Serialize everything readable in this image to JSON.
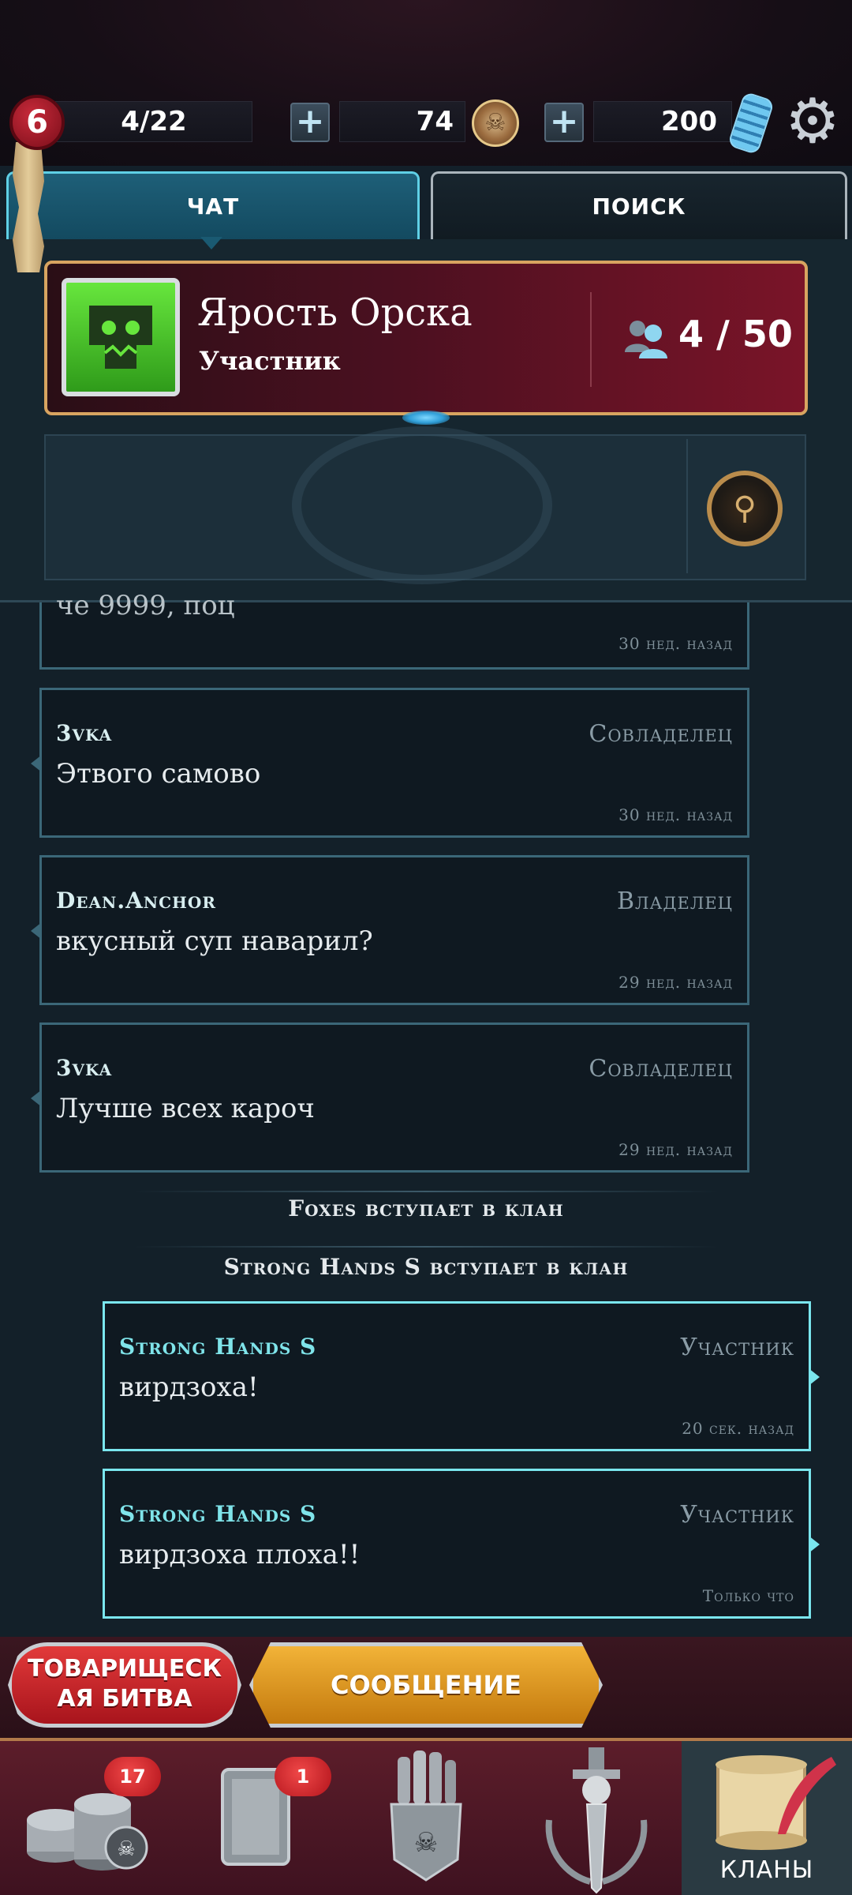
{
  "resources": {
    "level": "6",
    "cards": "4/22",
    "gold": "74",
    "gems": "200",
    "plus": "+"
  },
  "tabs": [
    {
      "label": "ЧАТ",
      "active": true
    },
    {
      "label": "ПОИСК",
      "active": false
    }
  ],
  "clan": {
    "name": "Ярость Орска",
    "rank": "Участник",
    "members": "4 / 50"
  },
  "chat": {
    "partial_text": "че 9999, поц",
    "partial_time": "30 нед. назад",
    "messages": [
      {
        "author": "3vka",
        "role": "Совладелец",
        "text": "Этвого самово",
        "time": "30 нед. назад",
        "own": false
      },
      {
        "author": "Dean.Anchor",
        "role": "Владелец",
        "text": "вкусный суп наварил?",
        "time": "29 нед. назад",
        "own": false
      },
      {
        "author": "3vka",
        "role": "Совладелец",
        "text": "Лучше всех кароч",
        "time": "29 нед. назад",
        "own": false
      },
      {
        "author": "Strong Hands S",
        "role": "Участник",
        "text": "вирдзоха!",
        "time": "20 сек. назад",
        "own": true
      },
      {
        "author": "Strong Hands S",
        "role": "Участник",
        "text": "вирдзоха плоха!!",
        "time": "Только что",
        "own": true
      }
    ],
    "system": [
      "Foxes вступает в клан",
      "Strong Hands S вступает в клан"
    ]
  },
  "actions": {
    "friendly_battle_line1": "ТОВАРИЩЕСК",
    "friendly_battle_line2": "АЯ БИТВА",
    "message": "СООБЩЕНИЕ"
  },
  "nav": {
    "items": [
      {
        "icon": "coins-icon",
        "badge": "17"
      },
      {
        "icon": "card-icon",
        "badge": "1"
      },
      {
        "icon": "gauntlet-icon",
        "badge": ""
      },
      {
        "icon": "sword-icon",
        "badge": ""
      },
      {
        "icon": "scroll-quill-icon",
        "label": "КЛАНЫ",
        "active": true
      }
    ]
  },
  "colors": {
    "accent": "#5fd0e6",
    "own_message_border": "#7ae6ee",
    "clan_card_border": "#d8a460",
    "badge_red": "#e23a3a",
    "message_button": "#f2b338"
  }
}
